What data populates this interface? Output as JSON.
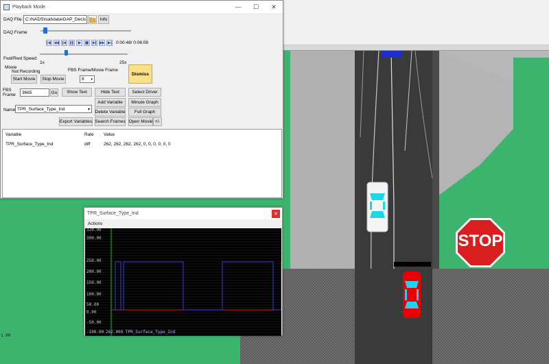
{
  "scene": {
    "stop_sign_text": "STOP",
    "side_text": "1.00"
  },
  "playback_window": {
    "title": "Playback Mode",
    "title_buttons": {
      "minimize": "—",
      "maximize": "☐",
      "close": "✕"
    },
    "daq_file_label": "DAQ File:",
    "daq_file_value": "C:\\NADS\\lsat\\data\\GAP_Decis",
    "info_button": "Info",
    "daq_frame_label": "DAQ Frame",
    "time_readout": "0:00:48/ 0:06:08",
    "speed_label": "Fwd/Rwd Speed:",
    "speed_min": "1x",
    "speed_max": "25x",
    "movie_label": "Movie",
    "movie_status": "Not Recording",
    "start_movie_button": "Start Movie",
    "stop_movie_button": "Stop Movie",
    "fbs_ratio_label": "FBS Frame/Movie Frame",
    "fbs_ratio_value": "8",
    "dismiss_button": "Dismiss",
    "fbs_frame_label": "FBS Frame",
    "fbs_frame_value": "3665",
    "go_button": "Go",
    "show_text_button": "Show Text",
    "hide_text_button": "Hide Text",
    "select_driver_button": "Select Driver",
    "add_variable_button": "Add Variable",
    "minute_graph_button": "Minute Graph",
    "name_label": "Name:",
    "name_value": "TPR_Surface_Type_Ind",
    "delete_variable_button": "Delete Variable",
    "full_graph_button": "Full Graph",
    "export_variables_button": "Export Variables",
    "search_frames_button": "Search Frames",
    "open_movie_button": "Open Movie",
    "plus_minus_button": "+/-",
    "table": {
      "headers": [
        "Variable",
        "Rate",
        "Value"
      ],
      "rows": [
        {
          "variable": "TPR_Surface_Type_Ind",
          "rate": "diff",
          "value": "262, 262, 262, 262, 0, 0, 0, 0, 0, 0"
        }
      ]
    }
  },
  "graph_window": {
    "title": "TPR_Surface_Type_Ind",
    "close_button": "✕",
    "menu_actions": "Actions",
    "ticks": [
      "320.00",
      "300.00",
      "250.00",
      "200.00",
      "150.00",
      "100.00",
      "50.00",
      "0.00",
      "-50.00",
      "-100.00"
    ],
    "caption": "262.000  TPR_Surface_Type_Ind"
  },
  "colors": {
    "grass": "#3cb46e",
    "road": "#3a3a3a",
    "shoulder": "#b4b4b4",
    "dismiss_bg": "#f8df8a",
    "graph_line": "#3b3bd8",
    "graph_zero": "#d01010",
    "cursor_line": "#18c018"
  }
}
